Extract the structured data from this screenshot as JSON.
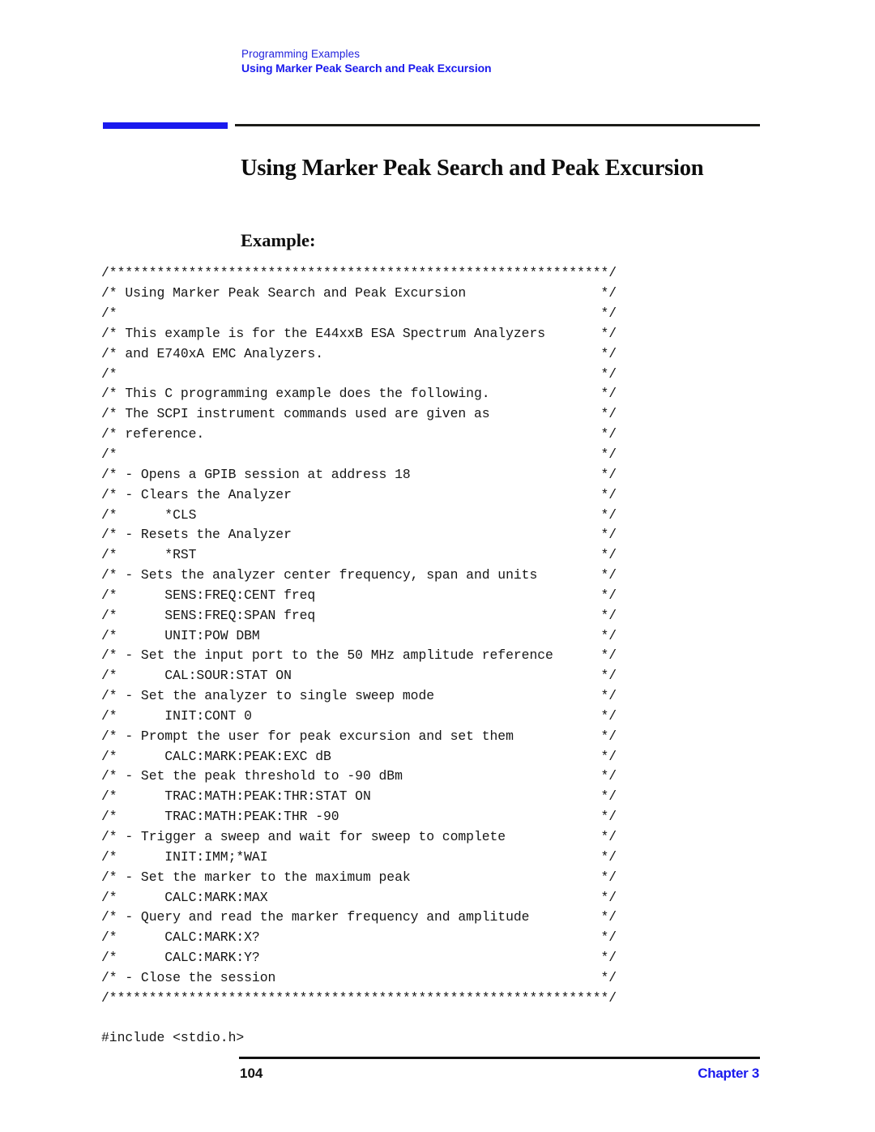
{
  "page": {
    "background_color": "#ffffff",
    "accent_color": "#1a1aee",
    "rule_color": "#1c1c18",
    "text_color": "#0d0d0d"
  },
  "running_header": {
    "line1": "Programming Examples",
    "line2": "Using Marker Peak Search and Peak Excursion"
  },
  "title": "Using Marker Peak Search and Peak Excursion",
  "section_heading": "Example:",
  "code": {
    "lines": [
      "/***************************************************************/",
      "/* Using Marker Peak Search and Peak Excursion                 */",
      "/*                                                             */",
      "/* This example is for the E44xxB ESA Spectrum Analyzers       */",
      "/* and E740xA EMC Analyzers.                                   */",
      "/*                                                             */",
      "/* This C programming example does the following.              */",
      "/* The SCPI instrument commands used are given as              */",
      "/* reference.                                                  */",
      "/*                                                             */",
      "/* - Opens a GPIB session at address 18                        */",
      "/* - Clears the Analyzer                                       */",
      "/*      *CLS                                                   */",
      "/* - Resets the Analyzer                                       */",
      "/*      *RST                                                   */",
      "/* - Sets the analyzer center frequency, span and units        */",
      "/*      SENS:FREQ:CENT freq                                    */",
      "/*      SENS:FREQ:SPAN freq                                    */",
      "/*      UNIT:POW DBM                                           */",
      "/* - Set the input port to the 50 MHz amplitude reference      */",
      "/*      CAL:SOUR:STAT ON                                       */",
      "/* - Set the analyzer to single sweep mode                     */",
      "/*      INIT:CONT 0                                            */",
      "/* - Prompt the user for peak excursion and set them           */",
      "/*      CALC:MARK:PEAK:EXC dB                                  */",
      "/* - Set the peak threshold to -90 dBm                         */",
      "/*      TRAC:MATH:PEAK:THR:STAT ON                             */",
      "/*      TRAC:MATH:PEAK:THR -90                                 */",
      "/* - Trigger a sweep and wait for sweep to complete            */",
      "/*      INIT:IMM;*WAI                                          */",
      "/* - Set the marker to the maximum peak                        */",
      "/*      CALC:MARK:MAX                                          */",
      "/* - Query and read the marker frequency and amplitude         */",
      "/*      CALC:MARK:X?                                           */",
      "/*      CALC:MARK:Y?                                           */",
      "/* - Close the session                                         */",
      "/***************************************************************/",
      "",
      "#include <stdio.h>"
    ]
  },
  "footer": {
    "page_number": "104",
    "chapter": "Chapter 3"
  }
}
